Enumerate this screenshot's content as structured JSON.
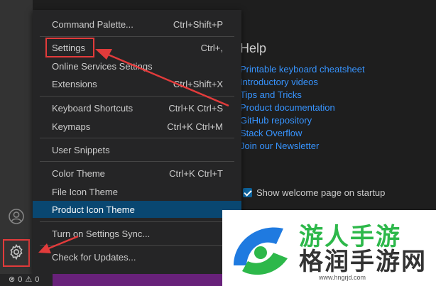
{
  "menu": {
    "items": [
      {
        "label": "Command Palette...",
        "shortcut": "Ctrl+Shift+P"
      },
      {
        "label": "Settings",
        "shortcut": "Ctrl+,"
      },
      {
        "label": "Online Services Settings",
        "shortcut": ""
      },
      {
        "label": "Extensions",
        "shortcut": "Ctrl+Shift+X"
      },
      {
        "label": "Keyboard Shortcuts",
        "shortcut": "Ctrl+K Ctrl+S"
      },
      {
        "label": "Keymaps",
        "shortcut": "Ctrl+K Ctrl+M"
      },
      {
        "label": "User Snippets",
        "shortcut": ""
      },
      {
        "label": "Color Theme",
        "shortcut": "Ctrl+K Ctrl+T"
      },
      {
        "label": "File Icon Theme",
        "shortcut": ""
      },
      {
        "label": "Product Icon Theme",
        "shortcut": ""
      },
      {
        "label": "Turn on Settings Sync...",
        "shortcut": ""
      },
      {
        "label": "Check for Updates...",
        "shortcut": ""
      }
    ]
  },
  "welcome": {
    "help_title": "Help",
    "links": [
      "Printable keyboard cheatsheet",
      "Introductory videos",
      "Tips and Tricks",
      "Product documentation",
      "GitHub repository",
      "Stack Overflow",
      "Join our Newsletter"
    ],
    "startup_label": "Show welcome page on startup",
    "startup_checked": true
  },
  "status": {
    "errors": "0",
    "warnings": "0"
  },
  "icons": {
    "accounts": "account-icon",
    "manage": "gear-icon",
    "error": "error-icon",
    "warning": "warning-icon"
  },
  "watermark": {
    "text_top": "游人手游",
    "text_main": "格润手游网",
    "url": "www.hngrjd.com"
  },
  "colors": {
    "highlight": "#094771",
    "link": "#3794ff",
    "status_bar": "#68217a",
    "annotation_red": "#e23b3b"
  }
}
